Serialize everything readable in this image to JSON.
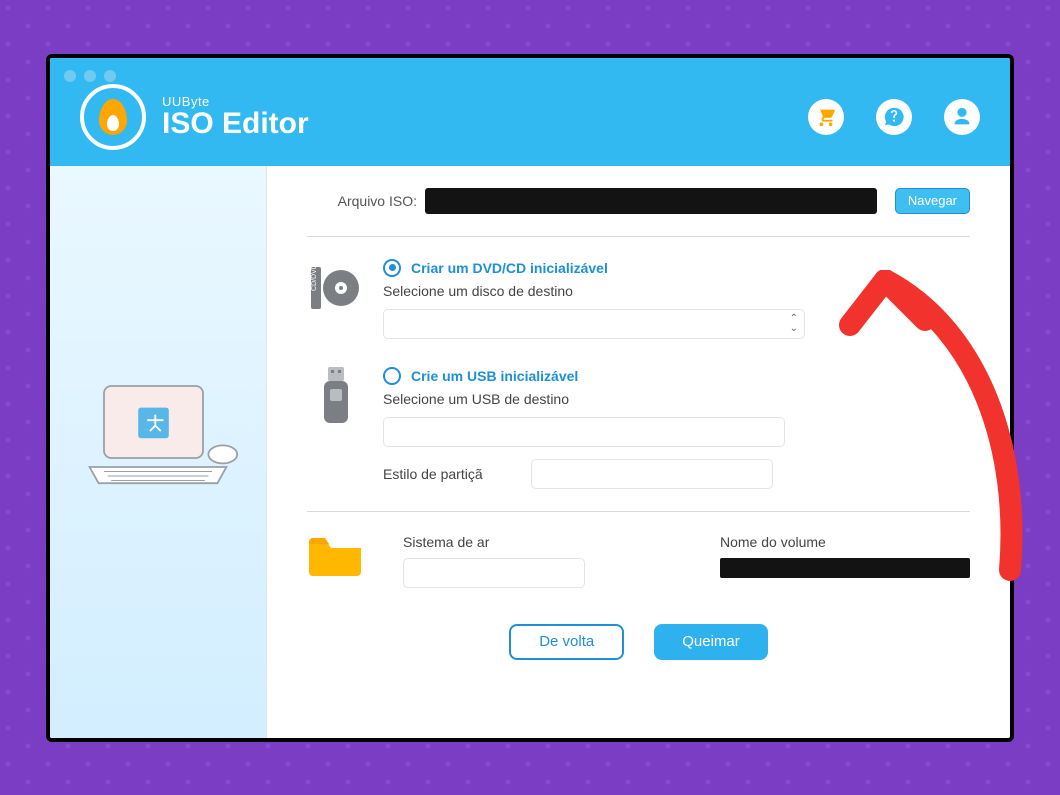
{
  "header": {
    "brand": "UUByte",
    "appname": "ISO Editor"
  },
  "form": {
    "iso_label": "Arquivo ISO:",
    "browse_label": "Navegar",
    "dvd": {
      "title": "Criar um DVD/CD inicializável",
      "subtitle": "Selecione um disco de destino"
    },
    "usb": {
      "title": "Crie um USB inicializável",
      "subtitle": "Selecione um USB de destino",
      "partition_label": "Estilo de partiçã"
    },
    "filesystem_label": "Sistema de ar",
    "volume_label": "Nome do volume"
  },
  "actions": {
    "back": "De volta",
    "burn": "Queimar"
  },
  "colors": {
    "accent": "#32B9F1",
    "primary": "#1E90D6",
    "orange": "#FFA600",
    "arrow": "#F2322D"
  }
}
